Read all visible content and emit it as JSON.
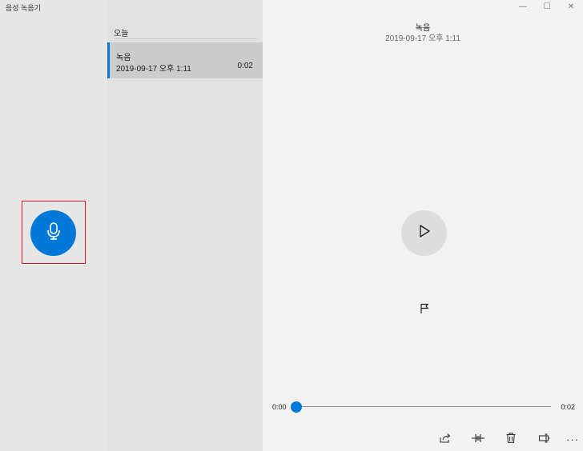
{
  "app": {
    "title": "음성 녹음기"
  },
  "list": {
    "group_header": "오늘",
    "items": [
      {
        "title": "녹음",
        "date": "2019-09-17 오후 1:11",
        "duration": "0:02"
      }
    ]
  },
  "player": {
    "title": "녹음",
    "date": "2019-09-17 오후 1:11",
    "time_start": "0:00",
    "time_end": "0:02",
    "progress": 0
  },
  "window_controls": {
    "minimize": "—",
    "maximize": "☐",
    "close": "✕"
  },
  "toolbar": {
    "more": "···"
  },
  "colors": {
    "accent": "#0078d7",
    "highlight_border": "#e81123"
  },
  "icons": [
    "microphone-icon",
    "play-icon",
    "flag-icon",
    "share-icon",
    "trim-icon",
    "delete-icon",
    "rename-icon",
    "more-icon"
  ]
}
